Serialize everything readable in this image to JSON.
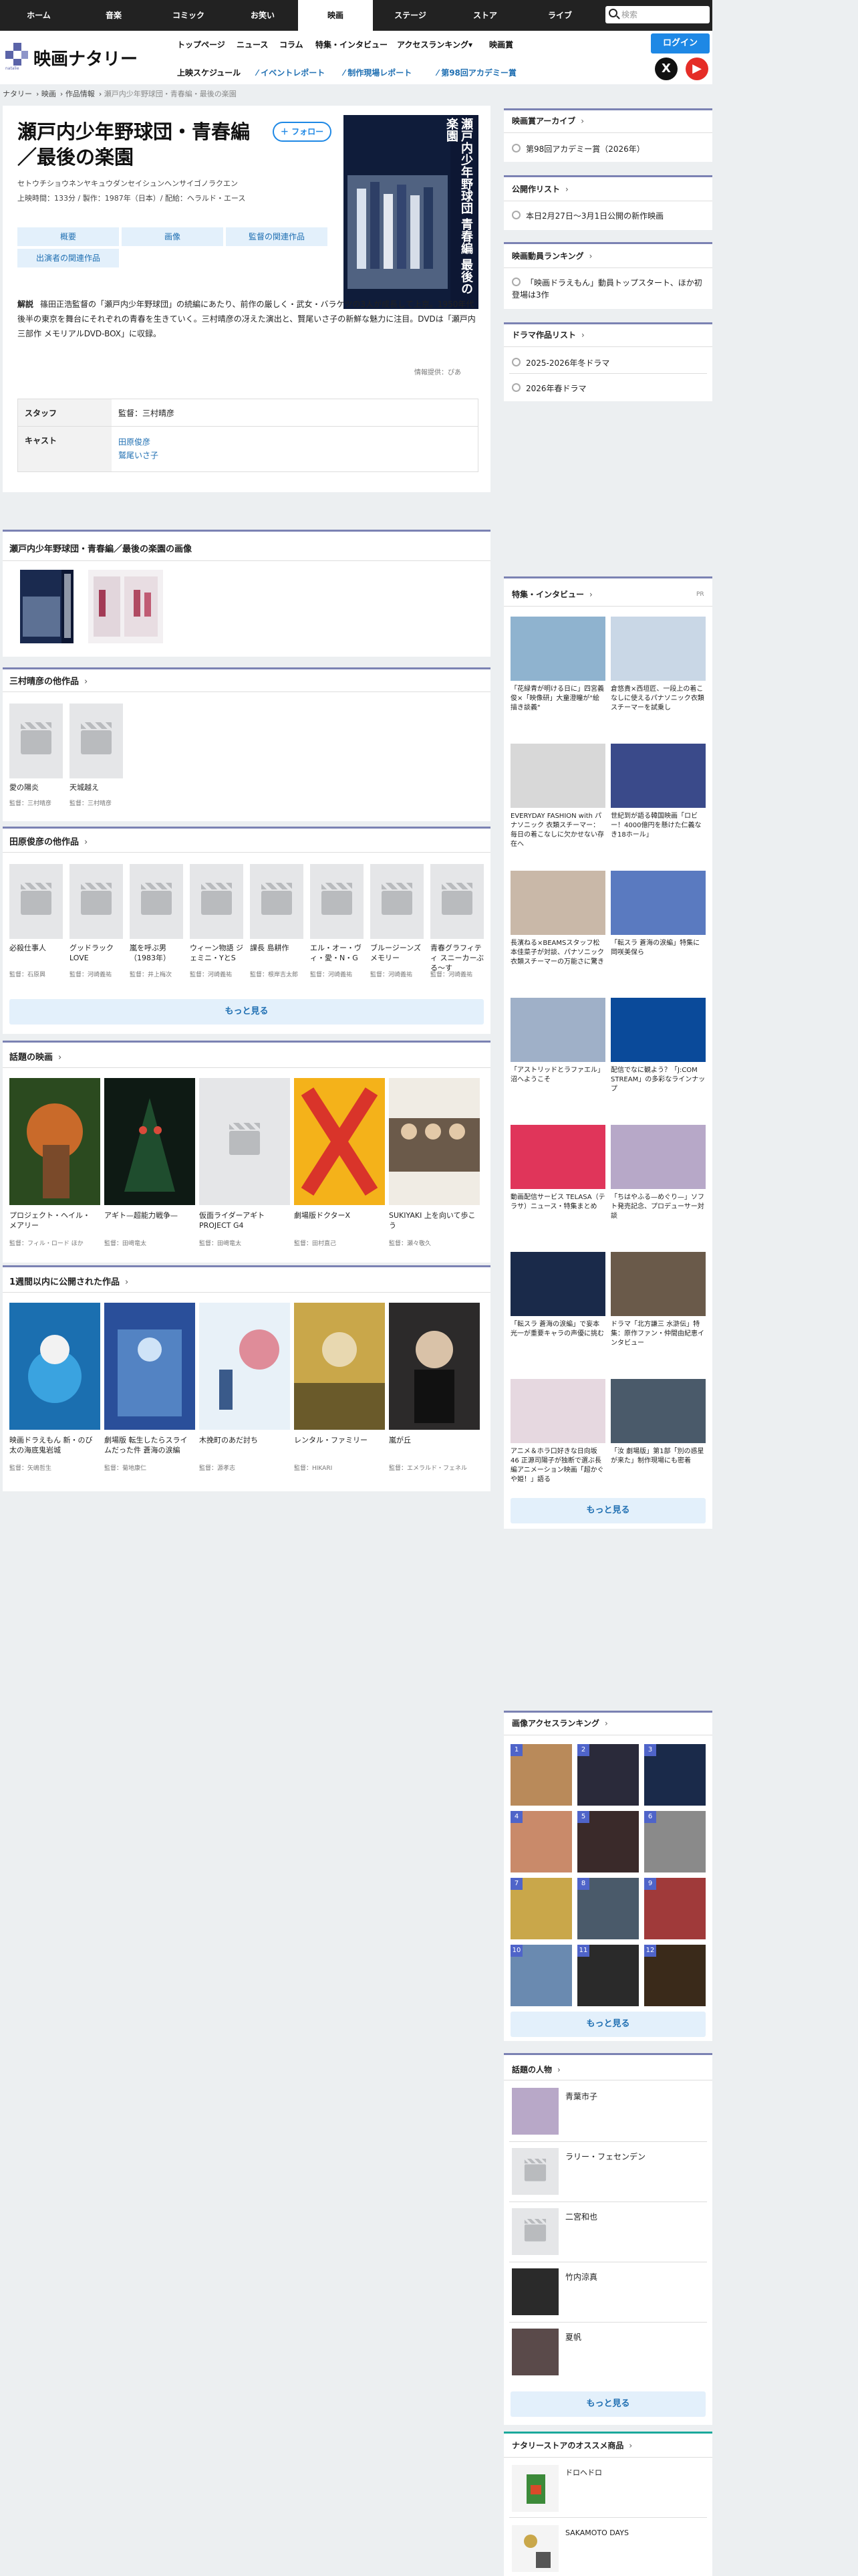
{
  "nav": {
    "items": [
      "ホーム",
      "音楽",
      "コミック",
      "お笑い",
      "映画",
      "ステージ",
      "ストア",
      "ライブ"
    ],
    "active": "映画",
    "search_placeholder": "検索"
  },
  "header": {
    "logo": "映画ナタリー",
    "menu_row1": [
      "トップページ",
      "ニュース",
      "コラム",
      "特集・インタビュー",
      "アクセスランキング▾",
      "映画賞"
    ],
    "menu_row2": [
      "上映スケジュール",
      "イベントレポート",
      "制作現場レポート",
      "第98回アカデミー賞"
    ],
    "login": "ログイン"
  },
  "breadcrumb": [
    "ナタリー",
    "映画",
    "作品情報",
    "瀬戸内少年野球団・青春編・最後の楽園"
  ],
  "work": {
    "title_line1": "瀬戸内少年野球団・青春編",
    "title_line2": "／最後の楽園",
    "follow": "フォロー",
    "reading": "セトウチショウネンヤキュウダンセイシュンヘンサイゴノラクエン",
    "meta": "上映時間：133分 / 製作：1987年（日本）/ 配給：ヘラルド・エース",
    "poster_text": "瀬戸内少年野球団 青春編 最後の楽園",
    "tabs": [
      "概要",
      "画像",
      "監督の関連作品",
      "出演者の関連作品"
    ],
    "desc_label": "解説",
    "desc": "篠田正浩監督の「瀬戸内少年野球団」の続編にあたり、前作の厳しく・武女・バラケツの3人が成長して上京。1950年代後半の東京を舞台にそれぞれの青春を生きていく。三村晴彦の冴えた演出と、賢尾いさ子の新鮮な魅力に注目。DVDは「瀬戸内三部作 メモリアルDVD-BOX」に収録。",
    "source": "情報提供：ぴあ",
    "staff_label": "スタッフ",
    "staff": "監督：三村晴彦",
    "cast_label": "キャスト",
    "cast": [
      "田原俊彦",
      "鷲尾いさ子"
    ]
  },
  "images_section": {
    "title": "瀬戸内少年野球団・青春編／最後の楽園の画像"
  },
  "director_section": {
    "title": "三村晴彦の他作品",
    "items": [
      {
        "t": "愛の陽炎",
        "d": "監督：三村晴彦"
      },
      {
        "t": "天城越え",
        "d": "監督：三村晴彦"
      }
    ]
  },
  "actor_section": {
    "title": "田原俊彦の他作品",
    "items": [
      {
        "t": "必殺仕事人",
        "d": "監督：石原興"
      },
      {
        "t": "グッドラックLOVE",
        "d": "監督：河崎義祐"
      },
      {
        "t": "嵐を呼ぶ男（1983年）",
        "d": "監督：井上梅次"
      },
      {
        "t": "ウィーン物語 ジェミニ・YとS",
        "d": "監督：河崎義祐"
      },
      {
        "t": "課長 島耕作",
        "d": "監督：根岸吉太郎"
      },
      {
        "t": "エル・オー・ヴィ・愛・N・G",
        "d": "監督：河崎義祐"
      },
      {
        "t": "ブルージーンズメモリー",
        "d": "監督：河崎義祐"
      },
      {
        "t": "青春グラフィティ スニーカーぶる～す",
        "d": "監督：河崎義祐"
      }
    ],
    "more": "もっと見る"
  },
  "popular_section": {
    "title": "話題の映画",
    "items": [
      {
        "t": "プロジェクト・ヘイル・メアリー",
        "d": "監督：フィル・ロード ほか"
      },
      {
        "t": "アギト—超能力戦争—",
        "d": "監督：田﨑竜太"
      },
      {
        "t": "仮面ライダーアギト PROJECT G4",
        "d": "監督：田﨑竜太"
      },
      {
        "t": "劇場版ドクターX",
        "d": "監督：田村直己"
      },
      {
        "t": "SUKIYAKI 上を向いて歩こう",
        "d": "監督：瀬々敬久"
      }
    ]
  },
  "recent_section": {
    "title": "1週間以内に公開された作品",
    "items": [
      {
        "t": "映画ドラえもん 新・のび太の海底鬼岩城",
        "d": "監督：矢嶋哲生"
      },
      {
        "t": "劇場版 転生したらスライムだった件 蒼海の涙編",
        "d": "監督：菊地康仁"
      },
      {
        "t": "木挽町のあだ討ち",
        "d": "監督：源孝志"
      },
      {
        "t": "レンタル・ファミリー",
        "d": "監督：HIKARI"
      },
      {
        "t": "嵐が丘",
        "d": "監督：エメラルド・フェネル"
      }
    ]
  },
  "sidebar": {
    "award": {
      "title": "映画賞アーカイブ",
      "item": "第98回アカデミー賞（2026年）"
    },
    "release": {
      "title": "公開作リスト",
      "item": "本日2月27日〜3月1日公開の新作映画"
    },
    "ranking": {
      "title": "映画動員ランキング",
      "item": "「映画ドラえもん」動員トップスタート、ほか初登場は3作"
    },
    "drama": {
      "title": "ドラマ作品リスト",
      "items": [
        "2025-2026年冬ドラマ",
        "2026年春ドラマ"
      ]
    },
    "features": {
      "title": "特集・インタビュー",
      "pr": "PR",
      "items": [
        "「花緑青が明ける日に」四宮義俊×「映像研」大童澄瞳が\"絵描き談義\"",
        "倉悠貴×西垣匠、一段上の着こなしに使えるパナソニック衣類スチーマーを試乗し",
        "EVERYDAY FASHION with パナソニック 衣類スチーマー：毎日の着こなしに欠かせない存在へ",
        "世紀到が語る韓国映画「ロビー！4000億円を懸けた仁義なき18ホール」",
        "長濱ねる×BEAMSスタッフ松本佳菜子が対談、パナソニック衣類スチーマーの万能さに驚き",
        "「転スラ 蒼海の涙編」特集に岡咲美保ら",
        "「アストリッドとラファエル」沼へようこそ",
        "配信でなに観よう？「J:COM STREAM」の多彩なラインナップ",
        "動画配信サービス TELASA（テラサ）ニュース・特集まとめ",
        "「ちはやふる—めぐり—」ソフト発売記念、プロデューサー対談",
        "「転スラ 蒼海の涙編」で妄本光一が重要キャラの声優に挑む",
        "ドラマ「北方謙三 水滸伝」特集：原作ファン・仲間由紀恵インタビュー",
        "アニメ＆ホラ口好きな日向坂46 正源司陽子が独断で選ぶ長編アニメーション映画「超かぐや姫！」語る",
        "「汝 劇場版」第1部「別の惑星が来た」制作現場にも密着"
      ],
      "more": "もっと見る"
    },
    "image_rank": {
      "title": "画像アクセスランキング",
      "nums": [
        "1",
        "2",
        "3",
        "4",
        "5",
        "6",
        "7",
        "8",
        "9",
        "10",
        "11",
        "12"
      ],
      "more": "もっと見る"
    },
    "people": {
      "title": "話題の人物",
      "items": [
        "青葉市子",
        "ラリー・フェセンデン",
        "二宮和也",
        "竹内涼真",
        "夏帆"
      ],
      "more": "もっと見る"
    },
    "store": {
      "title": "ナタリーストアのオススメ商品",
      "items": [
        "ドロヘドロ",
        "SAKAMOTO DAYS"
      ]
    }
  },
  "colors": {
    "accent": "#1e88e5",
    "section_bar": "#7b82b3",
    "tab_bg": "#e3f0fb"
  }
}
